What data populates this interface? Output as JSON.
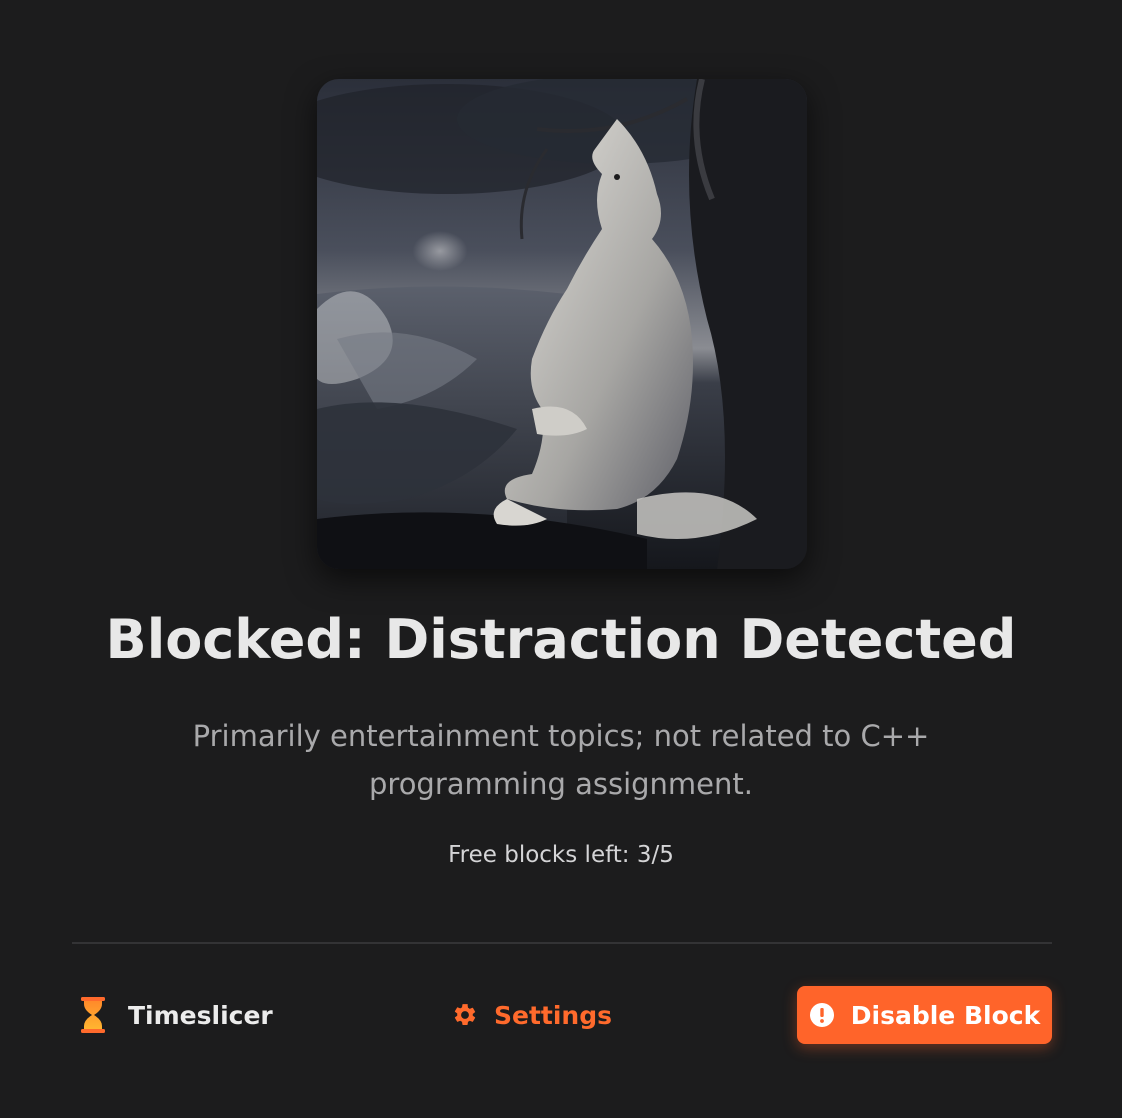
{
  "artwork": {
    "icon": "wolf-artwork-image"
  },
  "block": {
    "title": "Blocked: Distraction Detected",
    "reason": "Primarily entertainment topics; not related to C++ programming assignment.",
    "quota": "Free blocks left: 3/5"
  },
  "footer": {
    "brand_icon": "hourglass-icon",
    "brand_name": "Timeslicer",
    "settings_icon": "gear-icon",
    "settings_label": "Settings",
    "disable_icon": "alert-circle-icon",
    "disable_label": "Disable Block"
  },
  "colors": {
    "background": "#1c1c1d",
    "accent": "#ff642a",
    "title": "#e8e8e8",
    "muted": "#a9a9ab"
  }
}
